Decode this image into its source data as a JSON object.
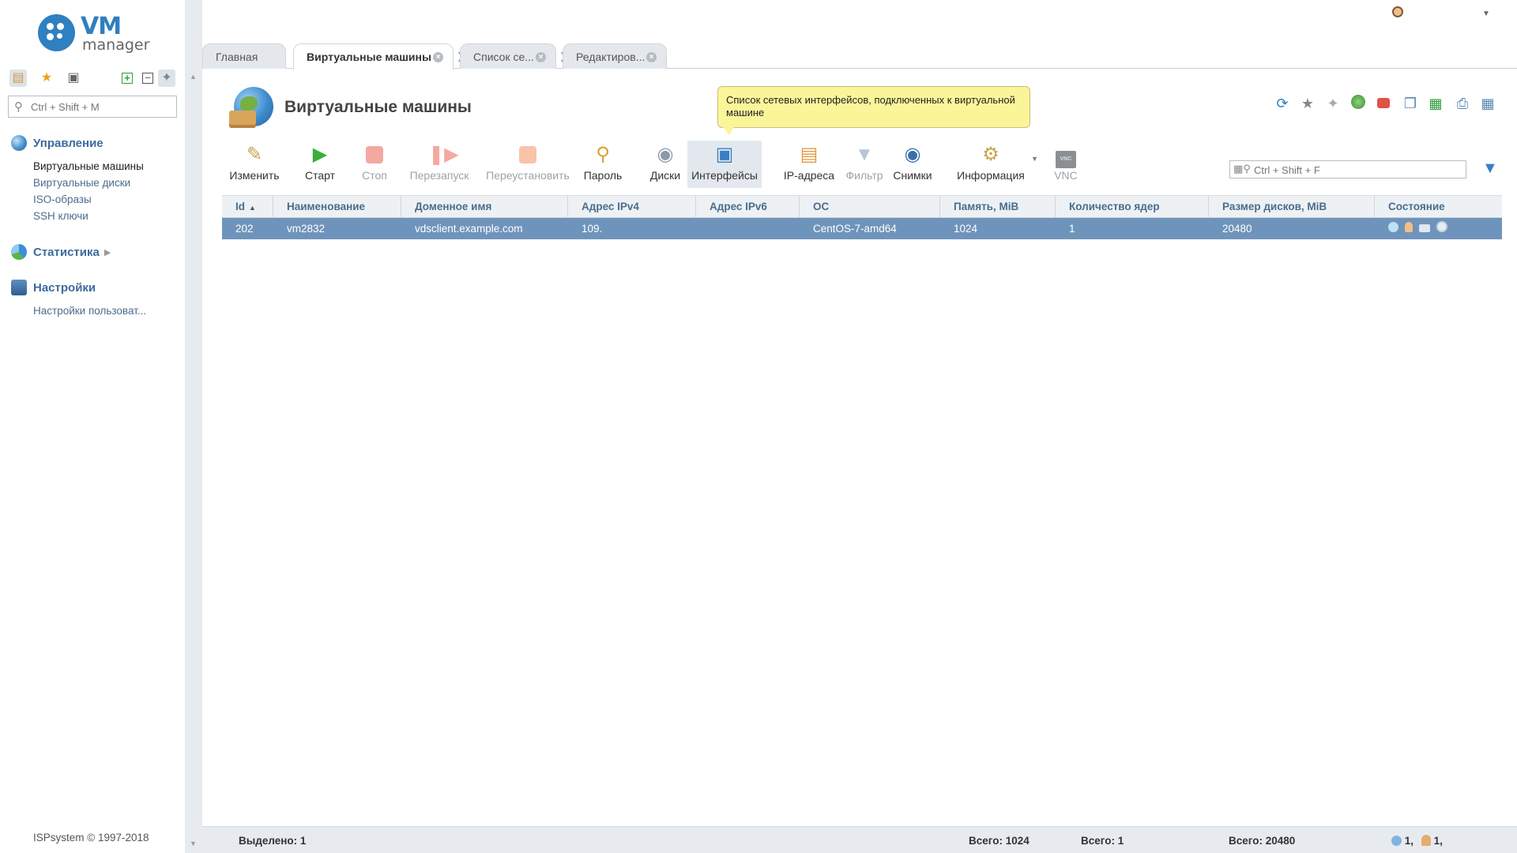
{
  "logo": {
    "brand": "VM",
    "sub": "manager"
  },
  "sidebar": {
    "search_placeholder": "Ctrl + Shift + M",
    "groups": [
      {
        "title": "Управление",
        "items": [
          "Виртуальные машины",
          "Виртуальные диски",
          "ISO-образы",
          "SSH ключи"
        ]
      },
      {
        "title": "Статистика",
        "items": []
      },
      {
        "title": "Настройки",
        "items": [
          "Настройки пользоват..."
        ]
      }
    ],
    "copyright": "ISPsystem © 1997-2018"
  },
  "tabs": [
    {
      "label": "Главная"
    },
    {
      "label": "Виртуальные машины"
    },
    {
      "label": "Список се..."
    },
    {
      "label": "Редактиров..."
    }
  ],
  "page": {
    "title": "Виртуальные машины",
    "tooltip": "Список сетевых интерфейсов, подключенных к виртуальной машине"
  },
  "toolbar": {
    "buttons": [
      {
        "label": "Изменить"
      },
      {
        "label": "Старт"
      },
      {
        "label": "Стоп"
      },
      {
        "label": "Перезапуск"
      },
      {
        "label": "Переустановить"
      },
      {
        "label": "Пароль"
      },
      {
        "label": "Диски"
      },
      {
        "label": "Интерфейсы"
      },
      {
        "label": "IP-адреса"
      },
      {
        "label": "Фильтр"
      },
      {
        "label": "Снимки"
      },
      {
        "label": "Информация"
      },
      {
        "label": "VNC"
      }
    ],
    "search_placeholder": "Ctrl + Shift + F"
  },
  "table": {
    "columns": [
      "Id",
      "Наименование",
      "Доменное имя",
      "Адрес IPv4",
      "Адрес IPv6",
      "ОС",
      "Память, MiB",
      "Количество ядер",
      "Размер дисков, MiB",
      "Состояние"
    ],
    "rows": [
      {
        "id": "202",
        "name": "vm2832",
        "domain": "vdsclient.example.com",
        "ipv4": "109.",
        "ipv6": "",
        "os": "CentOS-7-amd64",
        "memory": "1024",
        "cores": "1",
        "disk": "20480"
      }
    ]
  },
  "footer": {
    "selected": "Выделено: 1",
    "total_memory": "Всего: 1024",
    "total_cores": "Всего: 1",
    "total_disk": "Всего: 20480",
    "state_count_a": "1,",
    "state_count_b": "1,"
  },
  "colors": {
    "accent": "#2f7fc1",
    "selected_row": "#6f94bb",
    "tooltip": "#fbf59a"
  }
}
